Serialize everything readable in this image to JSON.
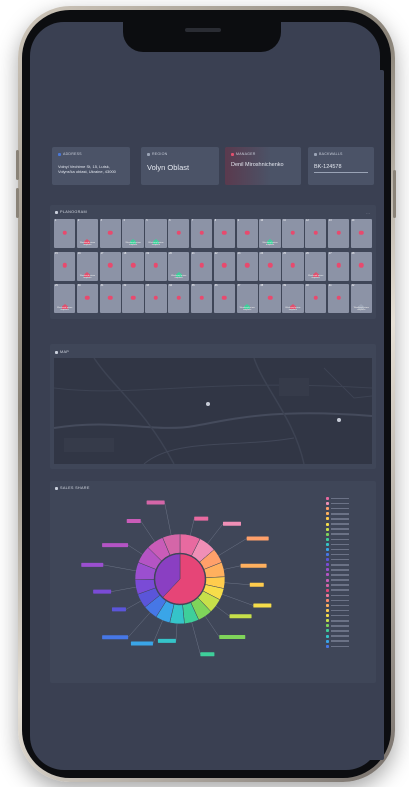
{
  "cards": {
    "address": {
      "label": "ADDRESS",
      "value": "Volnyi Vechirne St, 15, Lutsk, Volyns'ka oblast, Ukraine, 43000",
      "color": "#4a78d6"
    },
    "region": {
      "label": "REGION",
      "value": "Volyn Oblast",
      "color": "#9aa3b5"
    },
    "manager": {
      "label": "MANAGER",
      "value": "Denil Miroshnichenko",
      "color": "#e0506e"
    },
    "backwalls": {
      "label": "BACKWALLS",
      "value": "BK-124578",
      "color": "#9aa3b5"
    }
  },
  "planogram": {
    "title": "PLANOGRAM",
    "rows": [
      [
        {
          "n": "1",
          "t": "",
          "h": false
        },
        {
          "n": "2",
          "t": "Weekend prime outplace",
          "h": true,
          "c": "#e0506e"
        },
        {
          "n": "3",
          "t": "",
          "h": false
        },
        {
          "n": "4",
          "t": "Weekend prime outplace",
          "h": true,
          "c": "#3ecf9a"
        },
        {
          "n": "5",
          "t": "Weekend prime outplace",
          "h": true,
          "c": "#3ecf9a"
        },
        {
          "n": "6",
          "t": "",
          "h": false
        },
        {
          "n": "7",
          "t": "",
          "h": false
        },
        {
          "n": "8",
          "t": "",
          "h": false
        },
        {
          "n": "9",
          "t": "",
          "h": false
        },
        {
          "n": "10",
          "t": "Weekend prime outplace",
          "h": true,
          "c": "#3ecf9a"
        },
        {
          "n": "11",
          "t": "",
          "h": false
        },
        {
          "n": "12",
          "t": "",
          "h": false
        },
        {
          "n": "13",
          "t": "",
          "h": false
        },
        {
          "n": "14",
          "t": "",
          "h": false
        }
      ],
      [
        {
          "n": "15",
          "t": "",
          "h": false
        },
        {
          "n": "16",
          "t": "Weekend prime outplace",
          "h": true,
          "c": "#e0506e"
        },
        {
          "n": "17",
          "t": "",
          "h": false
        },
        {
          "n": "18",
          "t": "",
          "h": false
        },
        {
          "n": "19",
          "t": "",
          "h": false
        },
        {
          "n": "20",
          "t": "Weekend prime outplace",
          "h": true,
          "c": "#3ecf9a"
        },
        {
          "n": "21",
          "t": "",
          "h": false
        },
        {
          "n": "22",
          "t": "",
          "h": false
        },
        {
          "n": "23",
          "t": "",
          "h": false
        },
        {
          "n": "24",
          "t": "",
          "h": false
        },
        {
          "n": "25",
          "t": "",
          "h": false
        },
        {
          "n": "26",
          "t": "Weekend prime outplace",
          "h": true,
          "c": "#e0506e"
        },
        {
          "n": "27",
          "t": "",
          "h": false
        },
        {
          "n": "28",
          "t": "",
          "h": false
        }
      ],
      [
        {
          "n": "29",
          "t": "Weekend prime outplace",
          "h": true,
          "c": "#e0506e"
        },
        {
          "n": "30",
          "t": "",
          "h": false
        },
        {
          "n": "31",
          "t": "",
          "h": false
        },
        {
          "n": "32",
          "t": "",
          "h": false
        },
        {
          "n": "33",
          "t": "",
          "h": false
        },
        {
          "n": "34",
          "t": "",
          "h": false
        },
        {
          "n": "35",
          "t": "",
          "h": false
        },
        {
          "n": "36",
          "t": "",
          "h": false
        },
        {
          "n": "37",
          "t": "Weekend prime outplace",
          "h": true,
          "c": "#3ecf9a"
        },
        {
          "n": "38",
          "t": "",
          "h": false
        },
        {
          "n": "39",
          "t": "Weekend prime outplace",
          "h": true,
          "c": "#e0506e"
        },
        {
          "n": "40",
          "t": "",
          "h": false
        },
        {
          "n": "41",
          "t": "",
          "h": false
        },
        {
          "n": "42",
          "t": "Weekend prime outplace",
          "h": true,
          "c": "#9aa3b5"
        }
      ]
    ]
  },
  "map": {
    "title": "MAP"
  },
  "sales": {
    "title": "SALES SHARE"
  },
  "chart_data": {
    "type": "pie",
    "title": "SALES SHARE",
    "inner": [
      {
        "value": 62,
        "color": "#e64577"
      },
      {
        "value": 38,
        "color": "#8a3fc2"
      }
    ],
    "outer": [
      {
        "value": 7,
        "color": "#e86aa0"
      },
      {
        "value": 6,
        "color": "#f08fb6"
      },
      {
        "value": 5,
        "color": "#ffa06a"
      },
      {
        "value": 5,
        "color": "#ffb05e"
      },
      {
        "value": 4,
        "color": "#ffcc4d"
      },
      {
        "value": 4,
        "color": "#f6dd4a"
      },
      {
        "value": 5,
        "color": "#c7e04a"
      },
      {
        "value": 5,
        "color": "#7fd45a"
      },
      {
        "value": 5,
        "color": "#3ecf9a"
      },
      {
        "value": 5,
        "color": "#35c4c9"
      },
      {
        "value": 5,
        "color": "#3aa5e8"
      },
      {
        "value": 5,
        "color": "#4677e6"
      },
      {
        "value": 5,
        "color": "#5b55d9"
      },
      {
        "value": 5,
        "color": "#7a4bd6"
      },
      {
        "value": 6,
        "color": "#9b4fcf"
      },
      {
        "value": 6,
        "color": "#b454c4"
      },
      {
        "value": 6,
        "color": "#c95cb8"
      },
      {
        "value": 6,
        "color": "#d466a8"
      }
    ]
  },
  "legend": {
    "colors": [
      "#e86aa0",
      "#f08fb6",
      "#ffa06a",
      "#ffb05e",
      "#ffcc4d",
      "#f6dd4a",
      "#c7e04a",
      "#7fd45a",
      "#3ecf9a",
      "#35c4c9",
      "#3aa5e8",
      "#4677e6",
      "#5b55d9",
      "#7a4bd6",
      "#9b4fcf",
      "#b454c4",
      "#c95cb8",
      "#d466a8",
      "#e64577",
      "#f07a9c",
      "#ff8a6a",
      "#ffb05e",
      "#ffcc4d",
      "#f6dd4a",
      "#c7e04a",
      "#7fd45a",
      "#3ecf9a",
      "#35c4c9",
      "#3aa5e8",
      "#4677e6"
    ]
  }
}
